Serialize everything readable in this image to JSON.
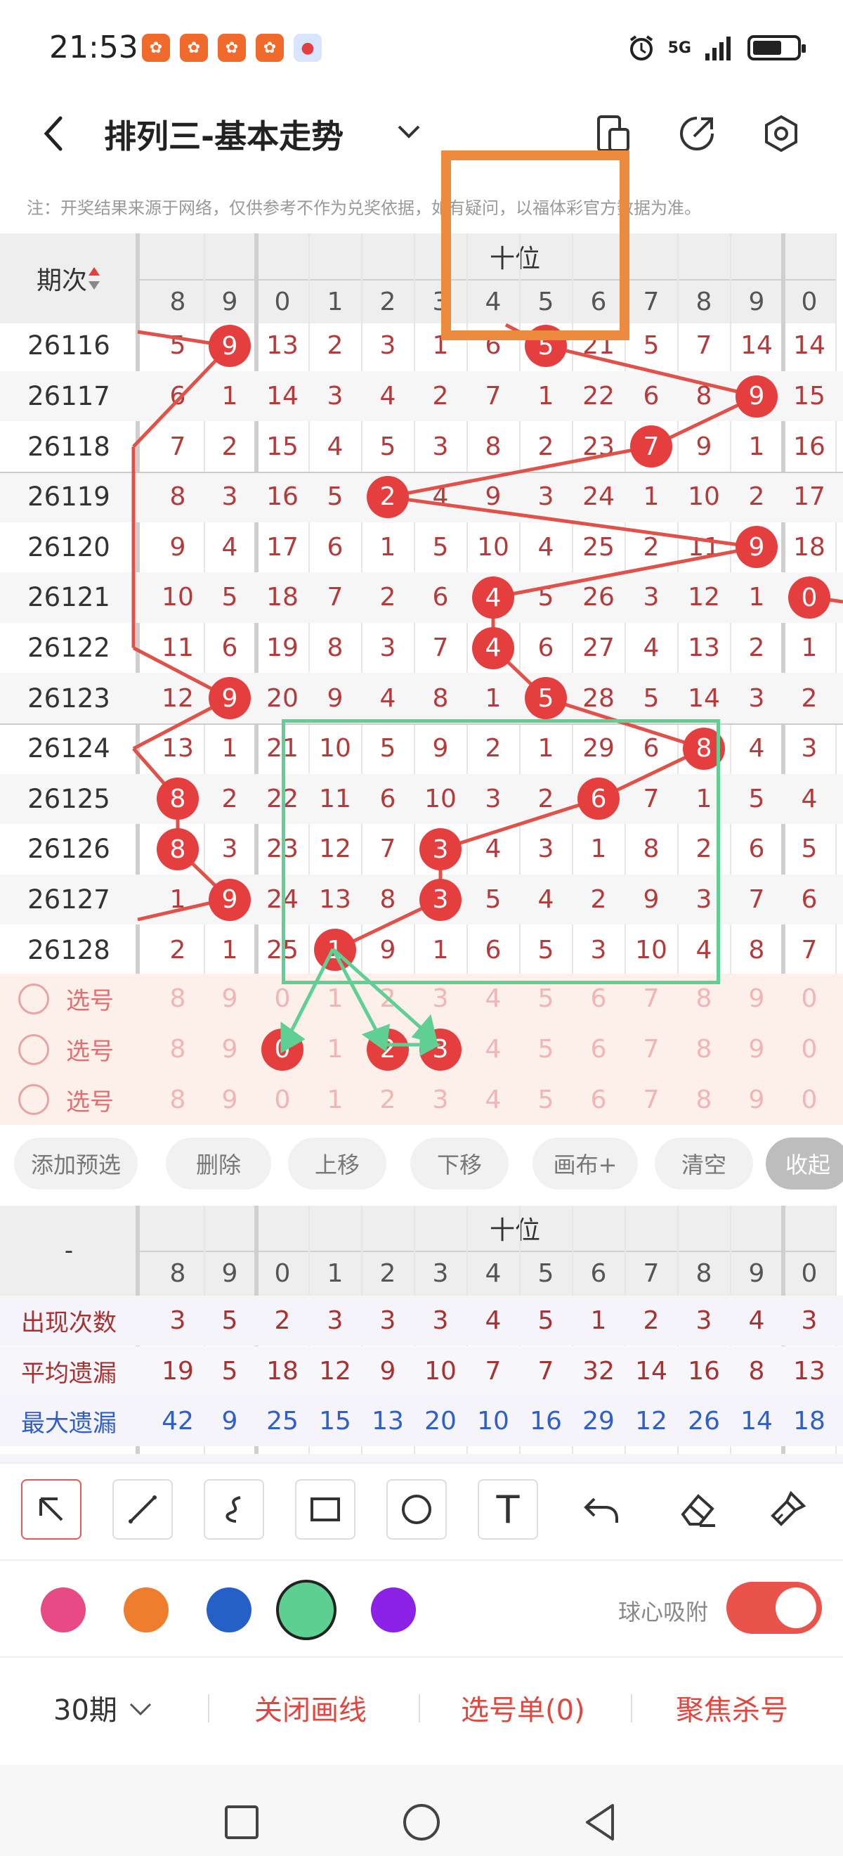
{
  "status": {
    "time": "21:53",
    "network": "5G",
    "app_icon_glyph": "✿"
  },
  "header": {
    "title": "排列三-基本走势"
  },
  "note": "注：开奖结果来源于网络，仅供参考不作为兑奖依据，如有疑问，以福体彩官方数据为准。",
  "table": {
    "period_header": "期次",
    "section_label": "十位",
    "columns": [
      "8",
      "9",
      "0",
      "1",
      "2",
      "3",
      "4",
      "5",
      "6",
      "7",
      "8",
      "9",
      "0"
    ],
    "rows": [
      {
        "period": "26116",
        "cells": [
          "5",
          "9",
          "13",
          "2",
          "3",
          "1",
          "6",
          "5",
          "21",
          "5",
          "7",
          "14",
          "14"
        ],
        "balls": [
          1,
          7
        ]
      },
      {
        "period": "26117",
        "cells": [
          "6",
          "1",
          "14",
          "3",
          "4",
          "2",
          "7",
          "1",
          "22",
          "6",
          "8",
          "9",
          "15"
        ],
        "balls": [
          11
        ]
      },
      {
        "period": "26118",
        "cells": [
          "7",
          "2",
          "15",
          "4",
          "5",
          "3",
          "8",
          "2",
          "23",
          "7",
          "9",
          "1",
          "16"
        ],
        "balls": [
          9
        ]
      },
      {
        "period": "26119",
        "cells": [
          "8",
          "3",
          "16",
          "5",
          "2",
          "4",
          "9",
          "3",
          "24",
          "1",
          "10",
          "2",
          "17"
        ],
        "balls": [
          4
        ]
      },
      {
        "period": "26120",
        "cells": [
          "9",
          "4",
          "17",
          "6",
          "1",
          "5",
          "10",
          "4",
          "25",
          "2",
          "11",
          "9",
          "18"
        ],
        "balls": [
          11
        ]
      },
      {
        "period": "26121",
        "cells": [
          "10",
          "5",
          "18",
          "7",
          "2",
          "6",
          "4",
          "5",
          "26",
          "3",
          "12",
          "1",
          "0"
        ],
        "balls": [
          6,
          12
        ]
      },
      {
        "period": "26122",
        "cells": [
          "11",
          "6",
          "19",
          "8",
          "3",
          "7",
          "4",
          "6",
          "27",
          "4",
          "13",
          "2",
          "1"
        ],
        "balls": [
          6
        ]
      },
      {
        "period": "26123",
        "cells": [
          "12",
          "9",
          "20",
          "9",
          "4",
          "8",
          "1",
          "5",
          "28",
          "5",
          "14",
          "3",
          "2"
        ],
        "balls": [
          1,
          7
        ]
      },
      {
        "period": "26124",
        "cells": [
          "13",
          "1",
          "21",
          "10",
          "5",
          "9",
          "2",
          "1",
          "29",
          "6",
          "8",
          "4",
          "3"
        ],
        "balls": [
          10
        ]
      },
      {
        "period": "26125",
        "cells": [
          "8",
          "2",
          "22",
          "11",
          "6",
          "10",
          "3",
          "2",
          "6",
          "7",
          "1",
          "5",
          "4"
        ],
        "balls": [
          0,
          8
        ]
      },
      {
        "period": "26126",
        "cells": [
          "8",
          "3",
          "23",
          "12",
          "7",
          "3",
          "4",
          "3",
          "1",
          "8",
          "2",
          "6",
          "5"
        ],
        "balls": [
          0,
          5
        ]
      },
      {
        "period": "26127",
        "cells": [
          "1",
          "9",
          "24",
          "13",
          "8",
          "3",
          "5",
          "4",
          "2",
          "9",
          "3",
          "7",
          "6"
        ],
        "balls": [
          1,
          5
        ]
      },
      {
        "period": "26128",
        "cells": [
          "2",
          "1",
          "25",
          "1",
          "9",
          "1",
          "6",
          "5",
          "3",
          "10",
          "4",
          "8",
          "7"
        ],
        "balls": [
          3
        ]
      }
    ],
    "select_label": "选号",
    "select_rows": [
      {
        "cells": [
          "8",
          "9",
          "0",
          "1",
          "2",
          "3",
          "4",
          "5",
          "6",
          "7",
          "8",
          "9",
          "0"
        ],
        "balls": []
      },
      {
        "cells": [
          "8",
          "9",
          "0",
          "1",
          "2",
          "3",
          "4",
          "5",
          "6",
          "7",
          "8",
          "9",
          "0"
        ],
        "balls": [
          2,
          4,
          5
        ]
      },
      {
        "cells": [
          "8",
          "9",
          "0",
          "1",
          "2",
          "3",
          "4",
          "5",
          "6",
          "7",
          "8",
          "9",
          "0"
        ],
        "balls": []
      }
    ]
  },
  "actions": [
    "添加预选",
    "删除",
    "上移",
    "下移",
    "画布+",
    "清空",
    "收起"
  ],
  "stats": {
    "dash": "-",
    "section_label": "十位",
    "columns": [
      "8",
      "9",
      "0",
      "1",
      "2",
      "3",
      "4",
      "5",
      "6",
      "7",
      "8",
      "9",
      "0"
    ],
    "rows": [
      {
        "label": "出现次数",
        "color": "#a83232",
        "values": [
          "3",
          "5",
          "2",
          "3",
          "3",
          "3",
          "4",
          "5",
          "1",
          "2",
          "3",
          "4",
          "3"
        ]
      },
      {
        "label": "平均遗漏",
        "color": "#a83232",
        "values": [
          "19",
          "5",
          "18",
          "12",
          "9",
          "10",
          "7",
          "7",
          "32",
          "14",
          "16",
          "8",
          "13"
        ]
      },
      {
        "label": "最大遗漏",
        "color": "#2f5fc8",
        "values": [
          "42",
          "9",
          "25",
          "15",
          "13",
          "20",
          "10",
          "16",
          "29",
          "12",
          "26",
          "14",
          "18"
        ]
      }
    ]
  },
  "tools": {
    "text_tool_glyph": "T"
  },
  "colors": {
    "swatches": [
      "#e84a86",
      "#ef7d2e",
      "#2560c9",
      "#5ccf91",
      "#8c22e6"
    ],
    "selected": "#5ccf91",
    "ball": "#e43e3e",
    "toggle": "#e9534b"
  },
  "snap_label": "球心吸附",
  "bottom": {
    "periods": "30期",
    "close_draw": "关闭画线",
    "pick_list": "选号单(0)",
    "focus_kill": "聚焦杀号"
  }
}
